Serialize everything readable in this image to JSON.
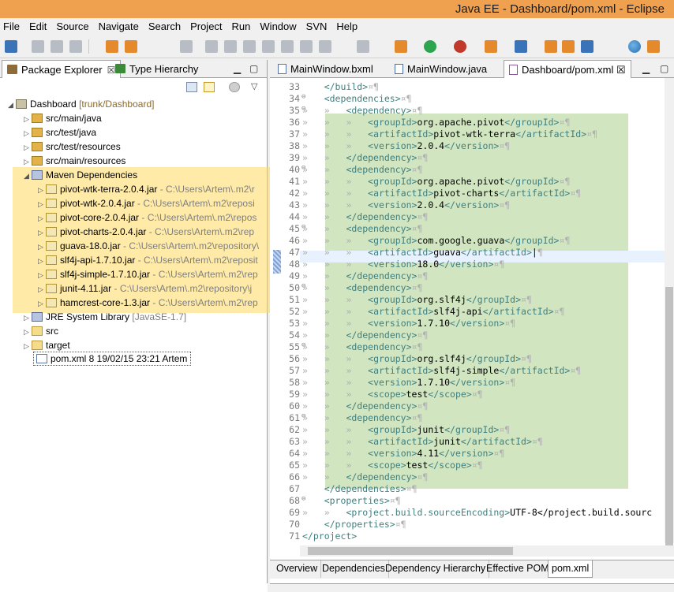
{
  "window": {
    "title": "Java EE - Dashboard/pom.xml - Eclipse"
  },
  "menu": [
    "File",
    "Edit",
    "Source",
    "Navigate",
    "Search",
    "Project",
    "Run",
    "Window",
    "SVN",
    "Help"
  ],
  "left_tabs": [
    {
      "label": "Package Explorer",
      "close": "☒"
    },
    {
      "label": "Type Hierarchy"
    }
  ],
  "tree": {
    "project": {
      "name": "Dashboard",
      "svn": "[trunk/Dashboard]"
    },
    "folders": [
      "src/main/java",
      "src/test/java",
      "src/test/resources",
      "src/main/resources"
    ],
    "maven": "Maven Dependencies",
    "jars": [
      {
        "name": "pivot-wtk-terra-2.0.4.jar",
        "path": " - C:\\Users\\Artem\\.m2\\r"
      },
      {
        "name": "pivot-wtk-2.0.4.jar",
        "path": " - C:\\Users\\Artem\\.m2\\reposi"
      },
      {
        "name": "pivot-core-2.0.4.jar",
        "path": " - C:\\Users\\Artem\\.m2\\repos"
      },
      {
        "name": "pivot-charts-2.0.4.jar",
        "path": " - C:\\Users\\Artem\\.m2\\rep"
      },
      {
        "name": "guava-18.0.jar",
        "path": " - C:\\Users\\Artem\\.m2\\repository\\"
      },
      {
        "name": "slf4j-api-1.7.10.jar",
        "path": " - C:\\Users\\Artem\\.m2\\reposit"
      },
      {
        "name": "slf4j-simple-1.7.10.jar",
        "path": " - C:\\Users\\Artem\\.m2\\rep"
      },
      {
        "name": "junit-4.11.jar",
        "path": " - C:\\Users\\Artem\\.m2\\repository\\j"
      },
      {
        "name": "hamcrest-core-1.3.jar",
        "path": " - C:\\Users\\Artem\\.m2\\rep"
      }
    ],
    "jre": {
      "name": "JRE System Library",
      "ver": "[JavaSE-1.7]"
    },
    "src": "src",
    "target": "target",
    "pom": "pom.xml 8  19/02/15 23:21  Artem"
  },
  "editor_tabs": [
    "MainWindow.bxml",
    "MainWindow.java",
    "Dashboard/pom.xml"
  ],
  "editor_close": "☒",
  "code": [
    {
      "n": "33",
      "f": "",
      "t": "    </build>¤¶"
    },
    {
      "n": "34",
      "f": "⊖",
      "t": "    <dependencies>¤¶"
    },
    {
      "n": "35",
      "f": "⊖",
      "t": "»   »   <dependency>¤¶"
    },
    {
      "n": "36",
      "f": "",
      "t": "»   »   »   <groupId>org.apache.pivot</groupId>¤¶"
    },
    {
      "n": "37",
      "f": "",
      "t": "»   »   »   <artifactId>pivot-wtk-terra</artifactId>¤¶"
    },
    {
      "n": "38",
      "f": "",
      "t": "»   »   »   <version>2.0.4</version>¤¶"
    },
    {
      "n": "39",
      "f": "",
      "t": "»   »   </dependency>¤¶"
    },
    {
      "n": "40",
      "f": "⊖",
      "t": "»   »   <dependency>¤¶"
    },
    {
      "n": "41",
      "f": "",
      "t": "»   »   »   <groupId>org.apache.pivot</groupId>¤¶"
    },
    {
      "n": "42",
      "f": "",
      "t": "»   »   »   <artifactId>pivot-charts</artifactId>¤¶"
    },
    {
      "n": "43",
      "f": "",
      "t": "»   »   »   <version>2.0.4</version>¤¶"
    },
    {
      "n": "44",
      "f": "",
      "t": "»   »   </dependency>¤¶"
    },
    {
      "n": "45",
      "f": "⊖",
      "t": "»   »   <dependency>¤¶"
    },
    {
      "n": "46",
      "f": "",
      "t": "»   »   »   <groupId>com.google.guava</groupId>¤¶"
    },
    {
      "n": "47",
      "f": "",
      "t": "»   »   »   <artifactId>guava</artifactId>|¶"
    },
    {
      "n": "48",
      "f": "",
      "t": "»   »   »   <version>18.0</version>¤¶"
    },
    {
      "n": "49",
      "f": "",
      "t": "»   »   </dependency>¤¶"
    },
    {
      "n": "50",
      "f": "⊖",
      "t": "»   »   <dependency>¤¶"
    },
    {
      "n": "51",
      "f": "",
      "t": "»   »   »   <groupId>org.slf4j</groupId>¤¶"
    },
    {
      "n": "52",
      "f": "",
      "t": "»   »   »   <artifactId>slf4j-api</artifactId>¤¶"
    },
    {
      "n": "53",
      "f": "",
      "t": "»   »   »   <version>1.7.10</version>¤¶"
    },
    {
      "n": "54",
      "f": "",
      "t": "»   »   </dependency>¤¶"
    },
    {
      "n": "55",
      "f": "⊖",
      "t": "»   »   <dependency>¤¶"
    },
    {
      "n": "56",
      "f": "",
      "t": "»   »   »   <groupId>org.slf4j</groupId>¤¶"
    },
    {
      "n": "57",
      "f": "",
      "t": "»   »   »   <artifactId>slf4j-simple</artifactId>¤¶"
    },
    {
      "n": "58",
      "f": "",
      "t": "»   »   »   <version>1.7.10</version>¤¶"
    },
    {
      "n": "59",
      "f": "",
      "t": "»   »   »   <scope>test</scope>¤¶"
    },
    {
      "n": "60",
      "f": "",
      "t": "»   »   </dependency>¤¶"
    },
    {
      "n": "61",
      "f": "⊖",
      "t": "»   »   <dependency>¤¶"
    },
    {
      "n": "62",
      "f": "",
      "t": "»   »   »   <groupId>junit</groupId>¤¶"
    },
    {
      "n": "63",
      "f": "",
      "t": "»   »   »   <artifactId>junit</artifactId>¤¶"
    },
    {
      "n": "64",
      "f": "",
      "t": "»   »   »   <version>4.11</version>¤¶"
    },
    {
      "n": "65",
      "f": "",
      "t": "»   »   »   <scope>test</scope>¤¶"
    },
    {
      "n": "66",
      "f": "",
      "t": "»   »   </dependency>¤¶"
    },
    {
      "n": "67",
      "f": "",
      "t": "    </dependencies>¤¶"
    },
    {
      "n": "68",
      "f": "⊖",
      "t": "    <properties>¤¶"
    },
    {
      "n": "69",
      "f": "",
      "t": "»   »   <project.build.sourceEncoding>UTF-8</project.build.sourc"
    },
    {
      "n": "70",
      "f": "",
      "t": "    </properties>¤¶"
    },
    {
      "n": "71",
      "f": "",
      "t": "</project>"
    }
  ],
  "pom_tabs": [
    "Overview",
    "Dependencies",
    "Dependency Hierarchy",
    "Effective POM",
    "pom.xml"
  ],
  "colors": {
    "title_bar": "#f0a14f",
    "maven_highlight": "#ffda5f",
    "dependency_highlight": "#aad08c",
    "xml_tag": "#3f7f7f"
  }
}
